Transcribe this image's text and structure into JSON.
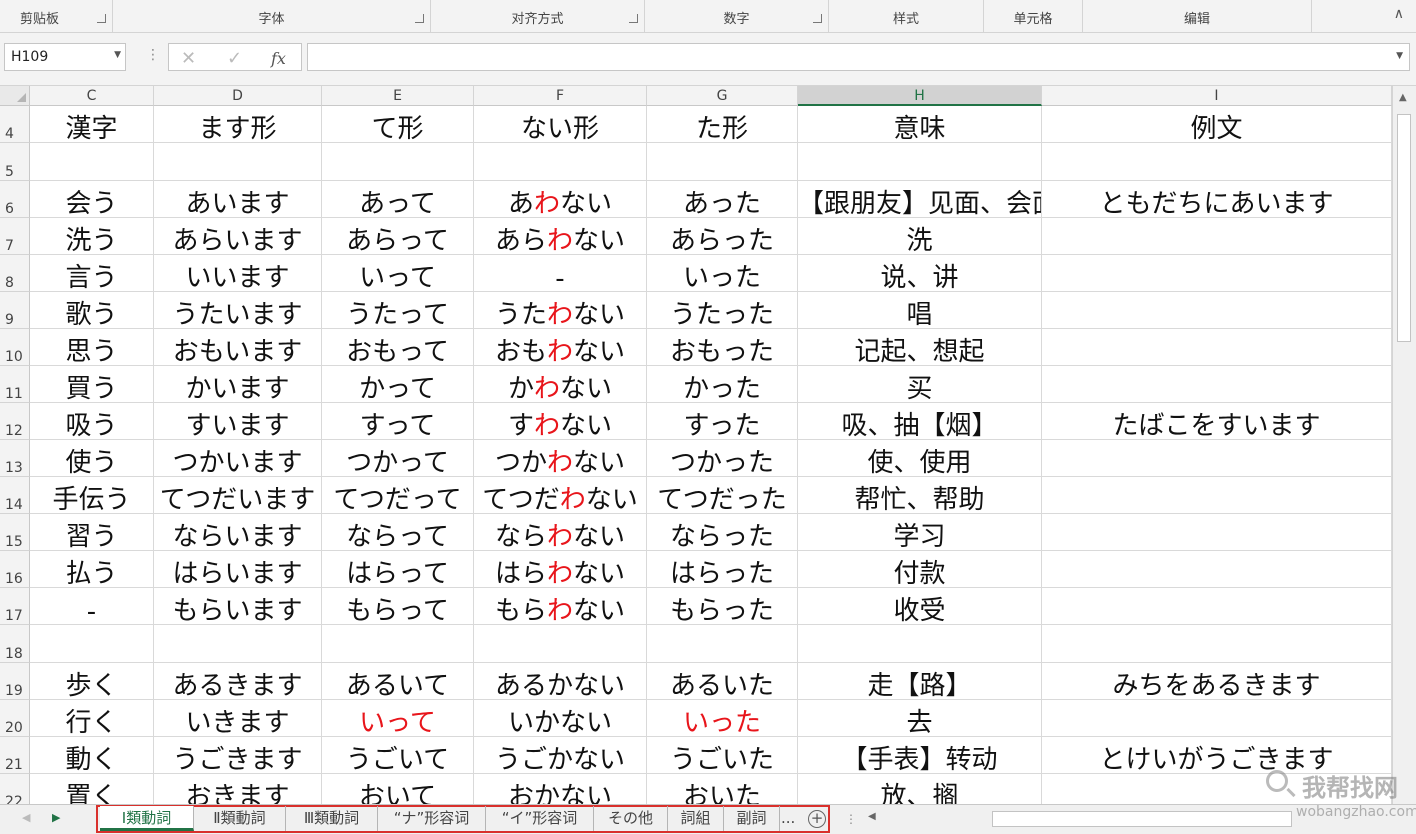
{
  "ribbon": {
    "groups": [
      "剪贴板",
      "字体",
      "对齐方式",
      "数字",
      "样式",
      "单元格",
      "编辑"
    ],
    "collapse_glyph": "∧"
  },
  "formula_bar": {
    "name_box": "H109",
    "cancel_glyph": "✕",
    "enter_glyph": "✓",
    "fx_label": "fx",
    "value": ""
  },
  "columns": [
    "C",
    "D",
    "E",
    "F",
    "G",
    "H",
    "I"
  ],
  "selected_column": "H",
  "rows": [
    {
      "num": "4",
      "cells": [
        {
          "t": "漢字"
        },
        {
          "t": "ます形"
        },
        {
          "t": "て形"
        },
        {
          "t": "ない形"
        },
        {
          "t": "た形"
        },
        {
          "t": "意味"
        },
        {
          "t": "例文"
        }
      ]
    },
    {
      "num": "5",
      "cells": [
        {
          "t": ""
        },
        {
          "t": ""
        },
        {
          "t": ""
        },
        {
          "t": ""
        },
        {
          "t": ""
        },
        {
          "t": ""
        },
        {
          "t": ""
        }
      ]
    },
    {
      "num": "6",
      "cells": [
        {
          "t": "会う"
        },
        {
          "t": "あいます"
        },
        {
          "t": "あって"
        },
        {
          "p": "あ",
          "r": "わ",
          "s": "ない"
        },
        {
          "t": "あった"
        },
        {
          "t": "【跟朋友】见面、会面",
          "left": true
        },
        {
          "t": "ともだちにあいます"
        }
      ]
    },
    {
      "num": "7",
      "cells": [
        {
          "t": "洗う"
        },
        {
          "t": "あらいます"
        },
        {
          "t": "あらって"
        },
        {
          "p": "あら",
          "r": "わ",
          "s": "ない"
        },
        {
          "t": "あらった"
        },
        {
          "t": "洗"
        },
        {
          "t": ""
        }
      ]
    },
    {
      "num": "8",
      "cells": [
        {
          "t": "言う"
        },
        {
          "t": "いいます"
        },
        {
          "t": "いって"
        },
        {
          "t": "-"
        },
        {
          "t": "いった"
        },
        {
          "t": "说、讲"
        },
        {
          "t": ""
        }
      ]
    },
    {
      "num": "9",
      "cells": [
        {
          "t": "歌う"
        },
        {
          "t": "うたいます"
        },
        {
          "t": "うたって"
        },
        {
          "p": "うた",
          "r": "わ",
          "s": "ない"
        },
        {
          "t": "うたった"
        },
        {
          "t": "唱"
        },
        {
          "t": ""
        }
      ]
    },
    {
      "num": "10",
      "cells": [
        {
          "t": "思う"
        },
        {
          "t": "おもいます"
        },
        {
          "t": "おもって"
        },
        {
          "p": "おも",
          "r": "わ",
          "s": "ない"
        },
        {
          "t": "おもった"
        },
        {
          "t": "记起、想起"
        },
        {
          "t": ""
        }
      ]
    },
    {
      "num": "11",
      "cells": [
        {
          "t": "買う"
        },
        {
          "t": "かいます"
        },
        {
          "t": "かって"
        },
        {
          "p": "か",
          "r": "わ",
          "s": "ない"
        },
        {
          "t": "かった"
        },
        {
          "t": "买"
        },
        {
          "t": ""
        }
      ]
    },
    {
      "num": "12",
      "cells": [
        {
          "t": "吸う"
        },
        {
          "t": "すいます"
        },
        {
          "t": "すって"
        },
        {
          "p": "す",
          "r": "わ",
          "s": "ない"
        },
        {
          "t": "すった"
        },
        {
          "t": "吸、抽【烟】"
        },
        {
          "t": "たばこをすいます"
        }
      ]
    },
    {
      "num": "13",
      "cells": [
        {
          "t": "使う"
        },
        {
          "t": "つかいます"
        },
        {
          "t": "つかって"
        },
        {
          "p": "つか",
          "r": "わ",
          "s": "ない"
        },
        {
          "t": "つかった"
        },
        {
          "t": "使、使用"
        },
        {
          "t": ""
        }
      ]
    },
    {
      "num": "14",
      "cells": [
        {
          "t": "手伝う"
        },
        {
          "t": "てつだいます"
        },
        {
          "t": "てつだって"
        },
        {
          "p": "てつだ",
          "r": "わ",
          "s": "ない"
        },
        {
          "t": "てつだった"
        },
        {
          "t": "帮忙、帮助"
        },
        {
          "t": ""
        }
      ]
    },
    {
      "num": "15",
      "cells": [
        {
          "t": "習う"
        },
        {
          "t": "ならいます"
        },
        {
          "t": "ならって"
        },
        {
          "p": "なら",
          "r": "わ",
          "s": "ない"
        },
        {
          "t": "ならった"
        },
        {
          "t": "学习"
        },
        {
          "t": ""
        }
      ]
    },
    {
      "num": "16",
      "cells": [
        {
          "t": "払う"
        },
        {
          "t": "はらいます"
        },
        {
          "t": "はらって"
        },
        {
          "p": "はら",
          "r": "わ",
          "s": "ない"
        },
        {
          "t": "はらった"
        },
        {
          "t": "付款"
        },
        {
          "t": ""
        }
      ]
    },
    {
      "num": "17",
      "cells": [
        {
          "t": "-"
        },
        {
          "t": "もらいます"
        },
        {
          "t": "もらって"
        },
        {
          "p": "もら",
          "r": "わ",
          "s": "ない"
        },
        {
          "t": "もらった"
        },
        {
          "t": "收受"
        },
        {
          "t": ""
        }
      ]
    },
    {
      "num": "18",
      "cells": [
        {
          "t": ""
        },
        {
          "t": ""
        },
        {
          "t": ""
        },
        {
          "t": ""
        },
        {
          "t": ""
        },
        {
          "t": ""
        },
        {
          "t": ""
        }
      ]
    },
    {
      "num": "19",
      "cells": [
        {
          "t": "歩く"
        },
        {
          "t": "あるきます"
        },
        {
          "t": "あるいて"
        },
        {
          "t": "あるかない"
        },
        {
          "t": "あるいた"
        },
        {
          "t": "走【路】"
        },
        {
          "t": "みちをあるきます"
        }
      ]
    },
    {
      "num": "20",
      "cells": [
        {
          "t": "行く"
        },
        {
          "t": "いきます"
        },
        {
          "t": "いって",
          "red": true
        },
        {
          "t": "いかない"
        },
        {
          "t": "いった",
          "red": true
        },
        {
          "t": "去"
        },
        {
          "t": ""
        }
      ]
    },
    {
      "num": "21",
      "cells": [
        {
          "t": "動く"
        },
        {
          "t": "うごきます"
        },
        {
          "t": "うごいて"
        },
        {
          "t": "うごかない"
        },
        {
          "t": "うごいた"
        },
        {
          "t": "【手表】转动"
        },
        {
          "t": "とけいがうごきます"
        }
      ]
    },
    {
      "num": "22",
      "cells": [
        {
          "t": "置く"
        },
        {
          "t": "おきます"
        },
        {
          "t": "おいて"
        },
        {
          "t": "おかない"
        },
        {
          "t": "おいた"
        },
        {
          "t": "放、搁"
        },
        {
          "t": ""
        }
      ]
    }
  ],
  "sheet_tabs": [
    "Ⅰ類動詞",
    "Ⅱ類動詞",
    "Ⅲ類動詞",
    "“ナ”形容词",
    "“イ”形容词",
    "その他",
    "詞組",
    "副詞"
  ],
  "active_tab_index": 0,
  "tabs_overflow": "...",
  "add_sheet_glyph": "+",
  "watermark": {
    "line1": "我帮找网",
    "line2": "wobangzhao.com"
  },
  "colors": {
    "accent": "#217346",
    "red_text": "#e8151b",
    "highlight_outline": "#d9302c"
  }
}
